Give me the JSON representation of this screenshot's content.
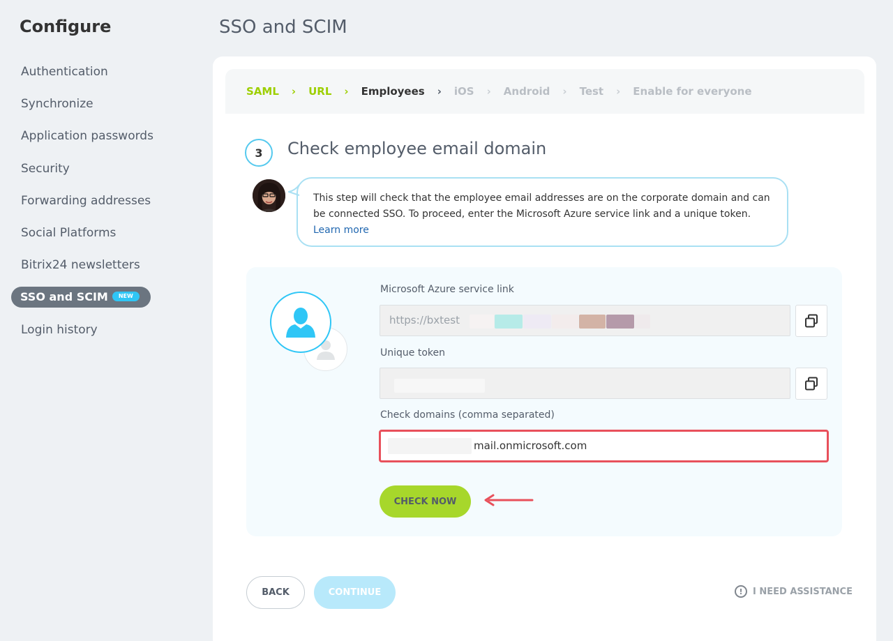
{
  "sidebar": {
    "title": "Configure",
    "items": [
      {
        "label": "Authentication"
      },
      {
        "label": "Synchronize"
      },
      {
        "label": "Application passwords"
      },
      {
        "label": "Security"
      },
      {
        "label": "Forwarding addresses"
      },
      {
        "label": "Social Platforms"
      },
      {
        "label": "Bitrix24 newsletters"
      },
      {
        "label": "SSO and SCIM",
        "badge": "NEW",
        "active": true
      },
      {
        "label": "Login history"
      }
    ]
  },
  "page": {
    "title": "SSO and SCIM"
  },
  "stepper": {
    "steps": [
      {
        "label": "SAML",
        "state": "done"
      },
      {
        "label": "URL",
        "state": "done"
      },
      {
        "label": "Employees",
        "state": "current"
      },
      {
        "label": "iOS",
        "state": "pending"
      },
      {
        "label": "Android",
        "state": "pending"
      },
      {
        "label": "Test",
        "state": "pending"
      },
      {
        "label": "Enable for everyone",
        "state": "pending"
      }
    ]
  },
  "step": {
    "number": "3",
    "title": "Check employee email domain",
    "description": "This step will check that the employee email addresses are on the corporate domain and can be connected SSO. To proceed, enter the Microsoft Azure service link and a unique token.",
    "learn_more": "Learn more"
  },
  "form": {
    "azure_label": "Microsoft Azure service link",
    "azure_value": "https://bxtest",
    "token_label": "Unique token",
    "token_value": "",
    "domains_label": "Check domains (comma separated)",
    "domains_value": "mail.onmicrosoft.com",
    "check_button": "CHECK NOW"
  },
  "footer": {
    "back": "BACK",
    "continue": "CONTINUE",
    "assistance": "I NEED ASSISTANCE"
  },
  "colors": {
    "accent_green": "#a7d72b",
    "accent_blue": "#2fc6f6",
    "highlight_red": "#e8505b"
  }
}
